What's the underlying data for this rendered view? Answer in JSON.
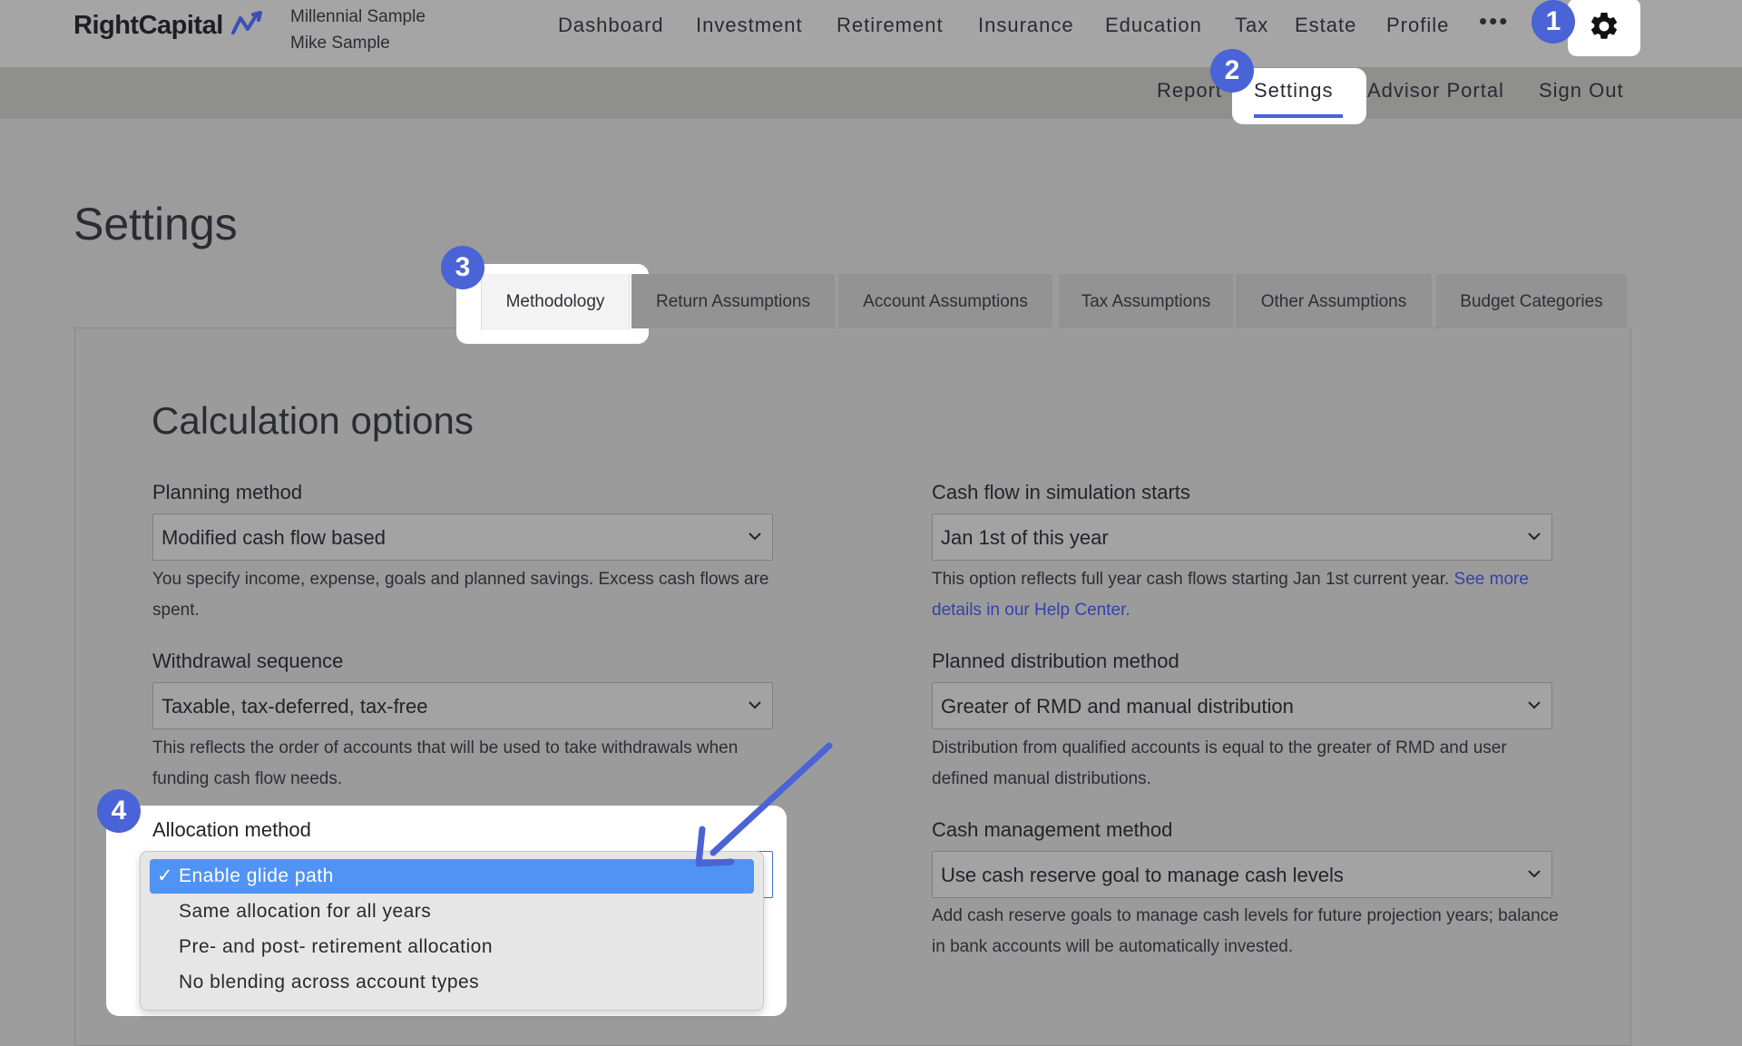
{
  "header": {
    "logo": "RightCapital",
    "client_line1": "Millennial Sample",
    "client_line2": "Mike Sample",
    "nav": [
      "Dashboard",
      "Investment",
      "Retirement",
      "Insurance",
      "Education",
      "Tax",
      "Estate",
      "Profile"
    ],
    "more": "•••",
    "gear_icon": "gear-icon"
  },
  "subnav": [
    "Report",
    "Settings",
    "Advisor Portal",
    "Sign Out"
  ],
  "badges": [
    "1",
    "2",
    "3",
    "4"
  ],
  "page_title": "Settings",
  "tabs": [
    "Methodology",
    "Return Assumptions",
    "Account Assumptions",
    "Tax Assumptions",
    "Other Assumptions",
    "Budget Categories"
  ],
  "section_title": "Calculation options",
  "fields": {
    "planning_method": {
      "label": "Planning method",
      "value": "Modified cash flow based",
      "help": "You specify income, expense, goals and planned savings. Excess cash flows are spent."
    },
    "withdrawal_sequence": {
      "label": "Withdrawal sequence",
      "value": "Taxable, tax-deferred, tax-free",
      "help": "This reflects the order of accounts that will be used to take withdrawals when funding cash flow needs."
    },
    "allocation_method": {
      "label": "Allocation method",
      "options": [
        "Enable glide path",
        "Same allocation for all years",
        "Pre- and post- retirement allocation",
        "No blending across account types"
      ],
      "selected_index": 0
    },
    "cash_flow_start": {
      "label": "Cash flow in simulation starts",
      "value": "Jan 1st of this year",
      "help": "This option reflects full year cash flows starting Jan 1st current year.",
      "help_link": "See more details in our Help Center."
    },
    "distribution_method": {
      "label": "Planned distribution method",
      "value": "Greater of RMD and manual distribution",
      "help": "Distribution from qualified accounts is equal to the greater of RMD and user defined manual distributions."
    },
    "cash_management": {
      "label": "Cash management method",
      "value": "Use cash reserve goal to manage cash levels",
      "help": "Add cash reserve goals to manage cash levels for future projection years; balance in bank accounts will be automatically invested."
    }
  },
  "colors": {
    "accent": "#4a63d6",
    "selected_option": "#4f93f4",
    "link": "#3342a8"
  }
}
